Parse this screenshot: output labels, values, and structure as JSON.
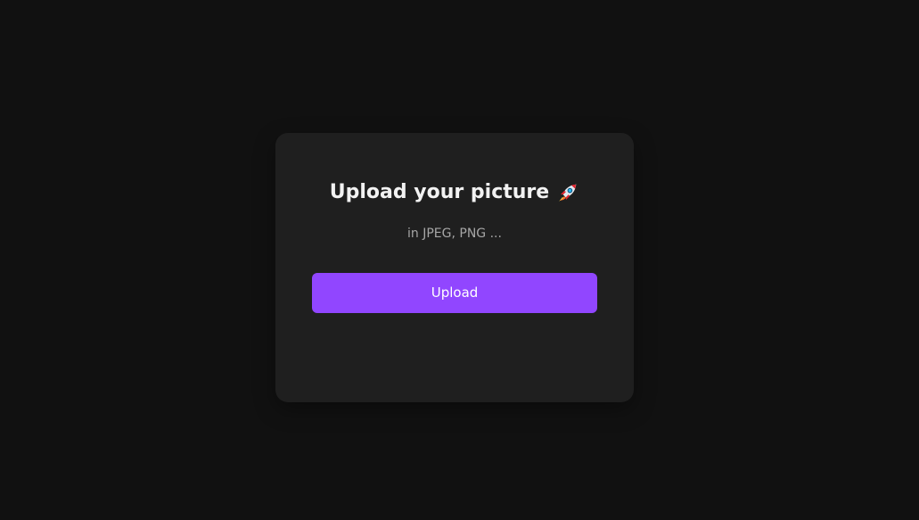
{
  "upload_card": {
    "title": "Upload your picture",
    "title_icon": "rocket-icon",
    "subtitle": "in JPEG, PNG ...",
    "button_label": "Upload",
    "accent_color": "#9146ff"
  }
}
